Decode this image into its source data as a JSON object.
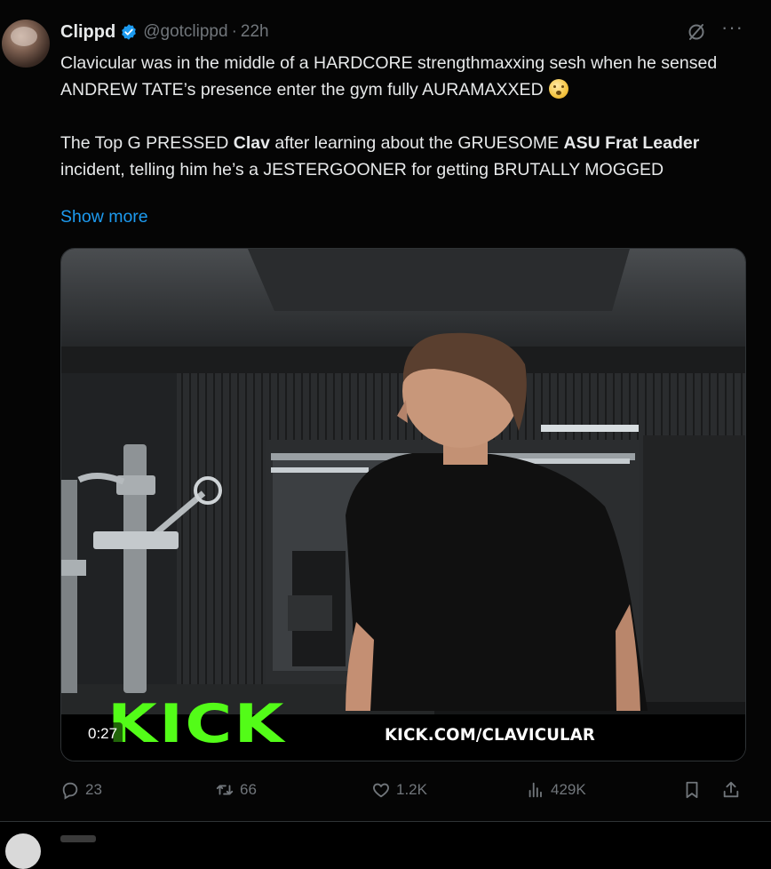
{
  "tweet": {
    "author_name": "Clippd",
    "handle": "@gotclippd",
    "separator": "·",
    "time": "22h",
    "text_line1_a": "Clavicular was in the middle of a HARDCORE strengthmaxxing sesh when he sensed ANDREW TATE’s presence enter the gym fully AURAMAXXED",
    "text_p2_a": "The Top G PRESSED ",
    "text_p2_b": "Clav",
    "text_p2_c": " after learning about the GRUESOME ",
    "text_p2_d": "ASU Frat Leader",
    "text_p2_e": " incident, telling him he’s a JESTERGOONER for getting BRUTALLY MOGGED",
    "show_more": "Show more"
  },
  "video": {
    "timestamp": "0:27",
    "overlay_logo": "KICK",
    "overlay_url": "KICK.COM/CLAVICULAR"
  },
  "actions": {
    "replies": "23",
    "reposts": "66",
    "likes": "1.2K",
    "views": "429K"
  },
  "colors": {
    "accent": "#1d9bf0",
    "kick_green": "#53fc18",
    "muted": "#71767b",
    "background": "#000000"
  }
}
